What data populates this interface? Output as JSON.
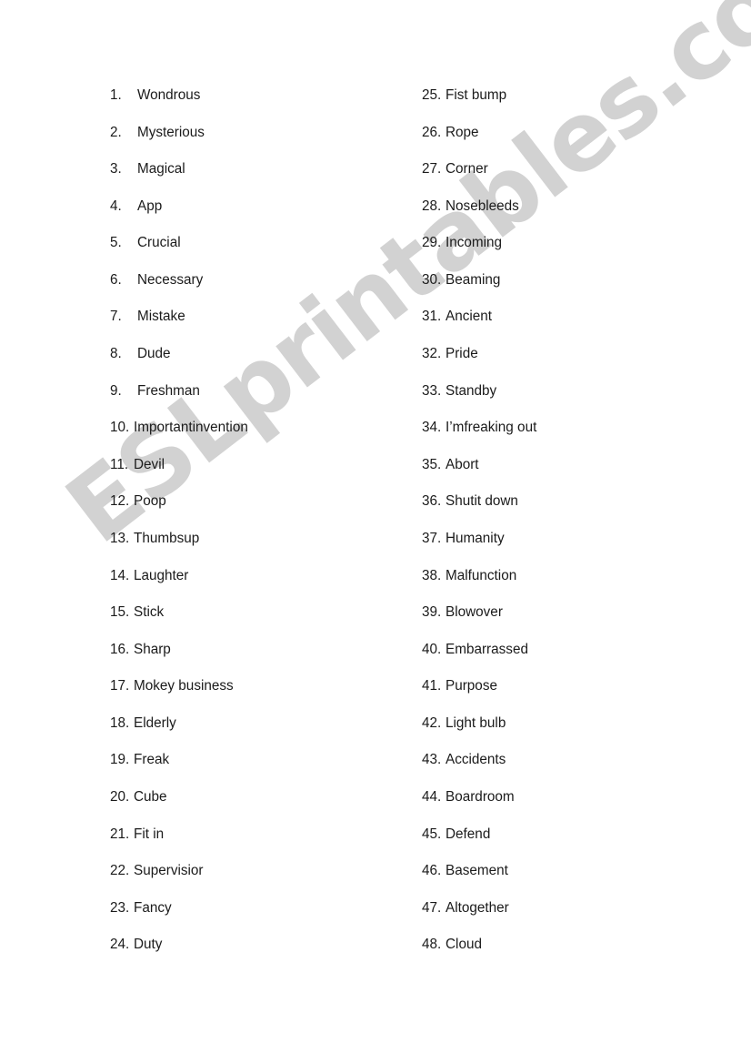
{
  "document": {
    "background_color": "#ffffff",
    "text_color": "#1b1b1b"
  },
  "watermark": {
    "text": "ESLprintables.com",
    "color": "#d2d2d2",
    "rotation_degrees": -37.5
  },
  "columns": [
    {
      "id": "left",
      "items": [
        {
          "number": "1.",
          "label": "Wondrous"
        },
        {
          "number": "2.",
          "label": "Mysterious"
        },
        {
          "number": "3.",
          "label": "Magical"
        },
        {
          "number": "4.",
          "label": "App"
        },
        {
          "number": "5.",
          "label": "Crucial"
        },
        {
          "number": "6.",
          "label": "Necessary"
        },
        {
          "number": "7.",
          "label": "Mistake"
        },
        {
          "number": "8.",
          "label": "Dude"
        },
        {
          "number": "9.",
          "label": "Freshman"
        },
        {
          "number": "10.",
          "label": "Importantinvention"
        },
        {
          "number": "11.",
          "label": "Devil"
        },
        {
          "number": "12.",
          "label": "Poop"
        },
        {
          "number": "13.",
          "label": "Thumbsup"
        },
        {
          "number": "14.",
          "label": "Laughter"
        },
        {
          "number": "15.",
          "label": "Stick"
        },
        {
          "number": "16.",
          "label": "Sharp"
        },
        {
          "number": "17.",
          "label": "Mokey business"
        },
        {
          "number": "18.",
          "label": "Elderly"
        },
        {
          "number": "19.",
          "label": "Freak"
        },
        {
          "number": "20.",
          "label": "Cube"
        },
        {
          "number": "21.",
          "label": "Fit in"
        },
        {
          "number": "22.",
          "label": "Supervisior"
        },
        {
          "number": "23.",
          "label": "Fancy"
        },
        {
          "number": "24.",
          "label": "Duty"
        }
      ]
    },
    {
      "id": "right",
      "items": [
        {
          "number": "25.",
          "label": "Fist bump"
        },
        {
          "number": "26.",
          "label": "Rope"
        },
        {
          "number": "27.",
          "label": "Corner"
        },
        {
          "number": "28.",
          "label": "Nosebleeds"
        },
        {
          "number": "29.",
          "label": "Incoming"
        },
        {
          "number": "30.",
          "label": "Beaming"
        },
        {
          "number": "31.",
          "label": "Ancient"
        },
        {
          "number": "32.",
          "label": "Pride"
        },
        {
          "number": "33.",
          "label": "Standby"
        },
        {
          "number": "34.",
          "label": "I’mfreaking out"
        },
        {
          "number": "35.",
          "label": "Abort"
        },
        {
          "number": "36.",
          "label": "Shutit down"
        },
        {
          "number": "37.",
          "label": "Humanity"
        },
        {
          "number": "38.",
          "label": "Malfunction"
        },
        {
          "number": "39.",
          "label": "Blowover"
        },
        {
          "number": "40.",
          "label": "Embarrassed"
        },
        {
          "number": "41.",
          "label": "Purpose"
        },
        {
          "number": "42.",
          "label": "Light bulb"
        },
        {
          "number": "43.",
          "label": "Accidents"
        },
        {
          "number": "44.",
          "label": "Boardroom"
        },
        {
          "number": "45.",
          "label": "Defend"
        },
        {
          "number": "46.",
          "label": "Basement"
        },
        {
          "number": "47.",
          "label": "Altogether"
        },
        {
          "number": "48.",
          "label": "Cloud"
        }
      ]
    }
  ]
}
